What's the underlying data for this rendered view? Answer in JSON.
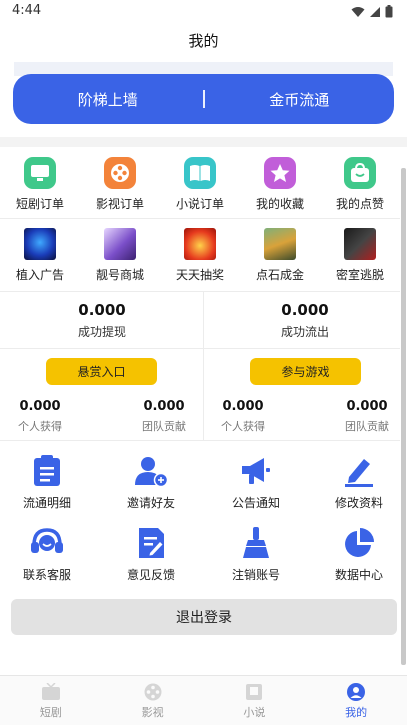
{
  "status": {
    "time": "4:44"
  },
  "header": {
    "title": "我的"
  },
  "banner": {
    "left_label": "阶梯上墙",
    "right_label": "金币流通"
  },
  "orders": [
    {
      "label": "短剧订单",
      "color": "#3fc88a"
    },
    {
      "label": "影视订单",
      "color": "#f3833a"
    },
    {
      "label": "小说订单",
      "color": "#38c5c9"
    },
    {
      "label": "我的收藏",
      "color": "#c15ed9"
    },
    {
      "label": "我的点赞",
      "color": "#3fc88a"
    }
  ],
  "features": [
    {
      "label": "植入广告"
    },
    {
      "label": "靓号商城"
    },
    {
      "label": "天天抽奖"
    },
    {
      "label": "点石成金"
    },
    {
      "label": "密室逃脱"
    }
  ],
  "stats": {
    "withdraw_value": "0.000",
    "withdraw_label": "成功提现",
    "flow_value": "0.000",
    "flow_label": "成功流出"
  },
  "reward": {
    "button": "悬赏入口",
    "personal_value": "0.000",
    "personal_label": "个人获得",
    "team_value": "0.000",
    "team_label": "团队贡献"
  },
  "game": {
    "button": "参与游戏",
    "personal_value": "0.000",
    "personal_label": "个人获得",
    "team_value": "0.000",
    "team_label": "团队贡献"
  },
  "functions": [
    {
      "label": "流通明细",
      "icon": "clipboard-icon"
    },
    {
      "label": "邀请好友",
      "icon": "add-user-icon"
    },
    {
      "label": "公告通知",
      "icon": "megaphone-icon"
    },
    {
      "label": "修改资料",
      "icon": "edit-icon"
    },
    {
      "label": "联系客服",
      "icon": "headset-icon"
    },
    {
      "label": "意见反馈",
      "icon": "feedback-icon"
    },
    {
      "label": "注销账号",
      "icon": "broom-icon"
    },
    {
      "label": "数据中心",
      "icon": "pie-chart-icon"
    }
  ],
  "logout_label": "退出登录",
  "tabs": [
    {
      "label": "短剧"
    },
    {
      "label": "影视"
    },
    {
      "label": "小说"
    },
    {
      "label": "我的",
      "active": true
    }
  ],
  "colors": {
    "accent": "#3a63e6",
    "button_yellow": "#f5c200"
  }
}
